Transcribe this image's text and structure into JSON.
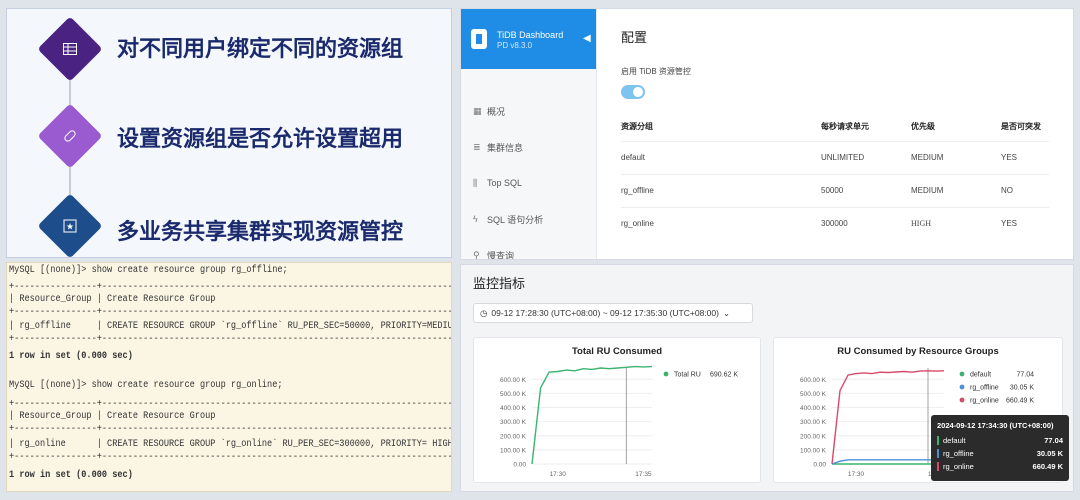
{
  "features": {
    "items": [
      {
        "text": "对不同用户绑定不同的资源组",
        "icon": "table-icon",
        "color": "#4a2282"
      },
      {
        "text": "设置资源组是否允许设置超用",
        "icon": "pill-icon",
        "color": "#9a5ad0"
      },
      {
        "text": "多业务共享集群实现资源管控",
        "icon": "shield-star-icon",
        "color": "#1d4d8a"
      }
    ]
  },
  "dashboard": {
    "brand": "TiDB Dashboard",
    "version": "PD v8.3.0",
    "nav": [
      {
        "label": "概况",
        "icon": "overview-icon"
      },
      {
        "label": "集群信息",
        "icon": "cluster-icon"
      },
      {
        "label": "Top SQL",
        "icon": "bar-chart-icon"
      },
      {
        "label": "SQL 语句分析",
        "icon": "statement-icon"
      },
      {
        "label": "慢查询",
        "icon": "slow-query-icon"
      }
    ],
    "title": "配置",
    "toggle_label": "启用 TiDB 资源管控",
    "columns": [
      "资源分组",
      "每秒请求单元",
      "优先级",
      "是否可突发"
    ],
    "rows": [
      [
        "default",
        "UNLIMITED",
        "MEDIUM",
        "YES"
      ],
      [
        "rg_offline",
        "50000",
        "MEDIUM",
        "NO"
      ],
      [
        "rg_online",
        "300000",
        "HIGH",
        "YES"
      ]
    ]
  },
  "terminal": {
    "lines": [
      "MySQL [(none)]> show create resource group rg_offline;",
      "+----------------+--------------------------------------------------------------------------+",
      "| Resource_Group | Create Resource Group                                                    |",
      "+----------------+--------------------------------------------------------------------------+",
      "| rg_offline     | CREATE RESOURCE GROUP `rg_offline` RU_PER_SEC=50000, PRIORITY=MEDIUM     |",
      "+----------------+--------------------------------------------------------------------------+",
      "1 row in set (0.000 sec)",
      "MySQL [(none)]> show create resource group rg_online;",
      "+----------------+-------------------------------------------------------------------------------------+",
      "| Resource_Group | Create Resource Group                                                               |",
      "+----------------+-------------------------------------------------------------------------------------+",
      "| rg_online      | CREATE RESOURCE GROUP `rg_online` RU_PER_SEC=300000, PRIORITY= HIGH , BURSTABLE |",
      "+----------------+-------------------------------------------------------------------------------------+",
      "1 row in set (0.000 sec)"
    ]
  },
  "monitoring": {
    "title": "监控指标",
    "time_range": "09-12 17:28:30 (UTC+08:00) ~ 09-12 17:35:30 (UTC+08:00)",
    "tooltip": {
      "time": "2024-09-12 17:34:30 (UTC+08:00)",
      "rows": [
        {
          "name": "default",
          "value": "77.04",
          "color": "#3cb371"
        },
        {
          "name": "rg_offline",
          "value": "30.05 K",
          "color": "#4a90d9"
        },
        {
          "name": "rg_online",
          "value": "660.49 K",
          "color": "#d84a6a"
        }
      ]
    }
  },
  "chart_data": [
    {
      "type": "line",
      "title": "Total RU Consumed",
      "x": [
        "17:28:30",
        "17:29",
        "17:29:30",
        "17:30",
        "17:30:30",
        "17:31",
        "17:31:30",
        "17:32",
        "17:32:30",
        "17:33",
        "17:33:30",
        "17:34",
        "17:34:30",
        "17:35",
        "17:35:30"
      ],
      "x_ticks": [
        "17:30",
        "17:35"
      ],
      "y_ticks": [
        "0.00",
        "100.00 K",
        "200.00 K",
        "300.00 K",
        "400.00 K",
        "500.00 K",
        "600.00 K"
      ],
      "ylim": [
        0,
        680000
      ],
      "series": [
        {
          "name": "Total RU",
          "color": "#3cb371",
          "legend_value": "690.62 K",
          "values": [
            0,
            540000,
            650000,
            655000,
            665000,
            660000,
            675000,
            670000,
            680000,
            675000,
            680000,
            685000,
            690000,
            688000,
            690000
          ]
        }
      ]
    },
    {
      "type": "line",
      "title": "RU Consumed by Resource Groups",
      "x": [
        "17:28:30",
        "17:29",
        "17:29:30",
        "17:30",
        "17:30:30",
        "17:31",
        "17:31:30",
        "17:32",
        "17:32:30",
        "17:33",
        "17:33:30",
        "17:34",
        "17:34:30",
        "17:35",
        "17:35:30"
      ],
      "x_ticks": [
        "17:30",
        "17:35"
      ],
      "y_ticks": [
        "0.00",
        "100.00 K",
        "200.00 K",
        "300.00 K",
        "400.00 K",
        "500.00 K",
        "600.00 K"
      ],
      "ylim": [
        0,
        680000
      ],
      "series": [
        {
          "name": "default",
          "color": "#3cb371",
          "legend_value": "77.04",
          "values": [
            0,
            0,
            0,
            0,
            0,
            0,
            0,
            0,
            0,
            0,
            0,
            0,
            77,
            77,
            77
          ]
        },
        {
          "name": "rg_offline",
          "color": "#4a90d9",
          "legend_value": "30.05 K",
          "values": [
            0,
            20000,
            30000,
            30000,
            30000,
            30000,
            30000,
            30000,
            30000,
            30000,
            30000,
            30000,
            30050,
            30000,
            30000
          ]
        },
        {
          "name": "rg_online",
          "color": "#d84a6a",
          "legend_value": "660.49 K",
          "values": [
            0,
            520000,
            630000,
            640000,
            645000,
            640000,
            650000,
            648000,
            652000,
            655000,
            650000,
            658000,
            660490,
            658000,
            660000
          ]
        }
      ]
    }
  ]
}
